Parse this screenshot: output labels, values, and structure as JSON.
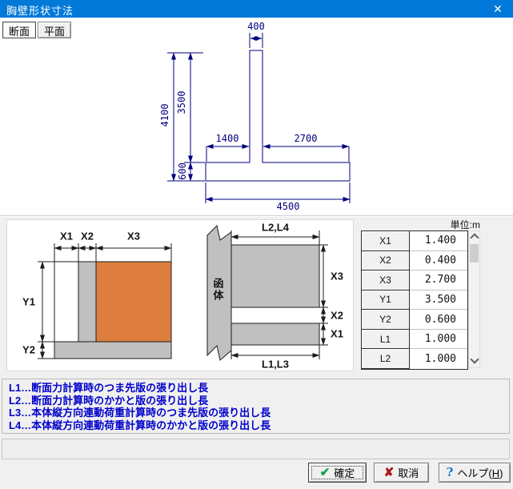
{
  "window": {
    "title": "胸壁形状寸法",
    "close_glyph": "✕"
  },
  "tabs": [
    {
      "label": "断面"
    },
    {
      "label": "平面"
    }
  ],
  "section_view": {
    "top_width": "400",
    "total_height": "4100",
    "wall_height": "3500",
    "footing_height": "600",
    "toe_width": "1400",
    "heel_width": "2700",
    "total_width": "4500"
  },
  "section_diagram": {
    "x1": "X1",
    "x2": "X2",
    "x3": "X3",
    "y1": "Y1",
    "y2": "Y2"
  },
  "plan_diagram": {
    "top_dim": "L2,L4",
    "bottom_dim": "L1,L3",
    "x3": "X3",
    "x2": "X2",
    "x1": "X1",
    "body_label": "函体"
  },
  "table": {
    "unit_label": "単位:m",
    "rows": [
      {
        "label": "X1",
        "value": "1.400"
      },
      {
        "label": "X2",
        "value": "0.400"
      },
      {
        "label": "X3",
        "value": "2.700"
      },
      {
        "label": "Y1",
        "value": "3.500"
      },
      {
        "label": "Y2",
        "value": "0.600"
      },
      {
        "label": "L1",
        "value": "1.000"
      },
      {
        "label": "L2",
        "value": "1.000"
      }
    ]
  },
  "notes": [
    "L1…断面力計算時のつま先版の張り出し長",
    "L2…断面力計算時のかかと版の張り出し長",
    "L3…本体縦方向連動荷重計算時のつま先版の張り出し長",
    "L4…本体縦方向連動荷重計算時のかかと版の張り出し長"
  ],
  "buttons": {
    "ok": "確定",
    "cancel": "取消",
    "help_prefix": "ヘルプ(",
    "help_key": "H",
    "help_suffix": ")"
  },
  "colors": {
    "titlebar_blue": "#0079d8",
    "drawing_navy": "#000080",
    "note_blue": "#0000cc",
    "fill_gray": "#c0c0c0",
    "fill_orange": "#dd7e3e",
    "check_green": "#0aa24c",
    "cross_red": "#b01313",
    "help_blue": "#1576d2"
  }
}
